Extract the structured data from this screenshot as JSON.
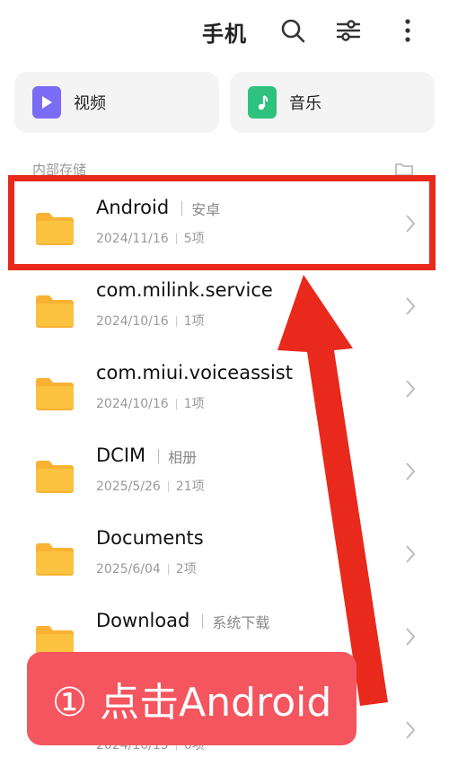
{
  "header": {
    "title": "手机"
  },
  "categories": [
    {
      "label": "视频",
      "color": "#7b6cf6"
    },
    {
      "label": "音乐",
      "color": "#2ec27e"
    }
  ],
  "section": {
    "label": "内部存储"
  },
  "folders": [
    {
      "name": "Android",
      "alias": "安卓",
      "date": "2024/11/16",
      "count": "5项"
    },
    {
      "name": "com.milink.service",
      "alias": "",
      "date": "2024/10/16",
      "count": "1项"
    },
    {
      "name": "com.miui.voiceassist",
      "alias": "",
      "date": "2024/10/16",
      "count": "1项"
    },
    {
      "name": "DCIM",
      "alias": "相册",
      "date": "2025/5/26",
      "count": "21项"
    },
    {
      "name": "Documents",
      "alias": "",
      "date": "2025/6/04",
      "count": "2项"
    },
    {
      "name": "Download",
      "alias": "系统下载",
      "date": "",
      "count": ""
    },
    {
      "name": "",
      "alias": "",
      "date": "2024/10/15",
      "count": "0项"
    }
  ],
  "annotation": {
    "text": "① 点击Android",
    "accent": "#e8291c",
    "banner_color": "#f4555e"
  }
}
